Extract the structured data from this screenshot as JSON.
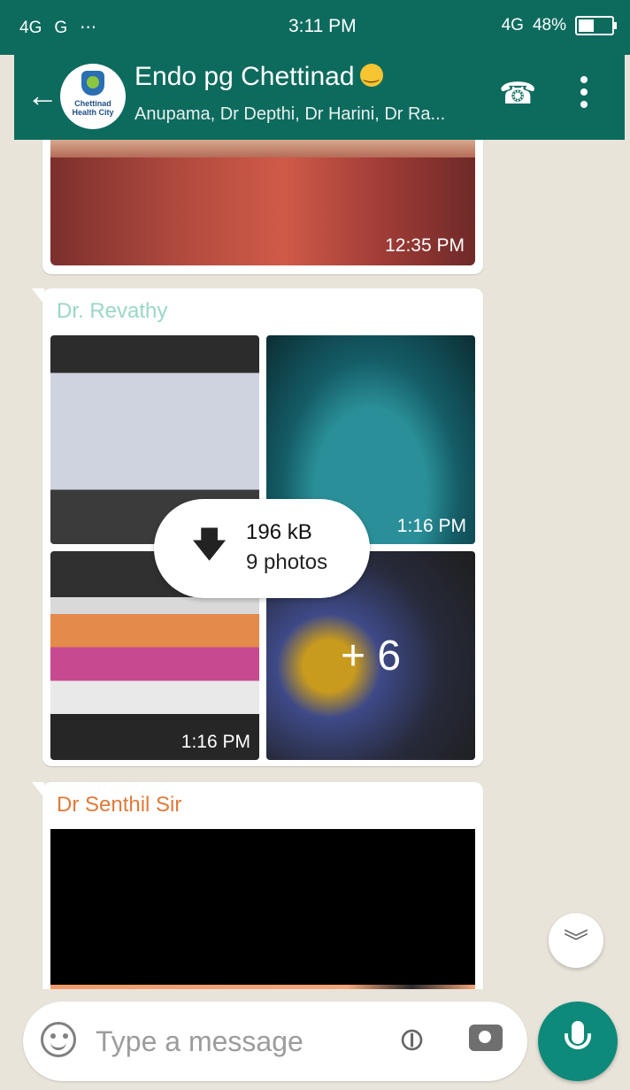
{
  "status_bar": {
    "left_indicators": [
      "4G",
      "G",
      "...",
      "⋯"
    ],
    "time": "3:11 PM",
    "network": "4G",
    "battery": "48%",
    "battery_level": 0.48
  },
  "header": {
    "title": "Endo pg Chettinad",
    "subtitle": "Anupama, Dr Depthi, Dr Harini, Dr Ra...",
    "avatar_text": "Chettinad Health City"
  },
  "messages": [
    {
      "time": "12:35 PM"
    },
    {
      "sender": "Dr. Revathy",
      "sender_color": "#9ad7c6",
      "tile_times": [
        "1:16 PM",
        "1:16 PM"
      ],
      "overflow_label": "+ 6",
      "download": {
        "size": "196 kB",
        "count": "9 photos"
      }
    },
    {
      "sender": "Dr Senthil Sir",
      "sender_color": "#e07a3a"
    }
  ],
  "composer": {
    "placeholder": "Type a message"
  },
  "icons": {
    "back": "back-arrow-icon",
    "call": "add-call-icon",
    "menu": "more-vert-icon",
    "download": "download-arrow-icon",
    "scroll": "double-chevron-down-icon",
    "emoji": "emoji-icon",
    "attach": "paperclip-icon",
    "camera": "camera-icon",
    "mic": "mic-icon"
  },
  "colors": {
    "primary": "#0d6b5e",
    "accent": "#0d8a79",
    "chat_bg": "#e9e4da"
  }
}
